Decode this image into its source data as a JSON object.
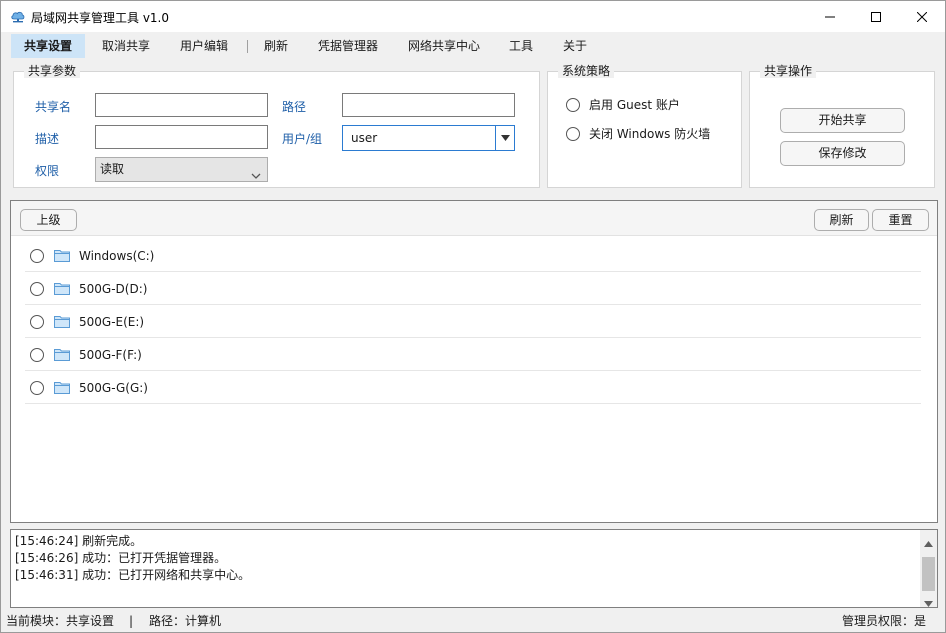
{
  "window": {
    "title": "局域网共享管理工具 v1.0",
    "icon": "cloud-network-icon"
  },
  "menu": {
    "items": [
      {
        "label": "共享设置",
        "active": true
      },
      {
        "label": "取消共享"
      },
      {
        "label": "用户编辑"
      },
      {
        "label": "刷新"
      },
      {
        "label": "凭据管理器"
      },
      {
        "label": "网络共享中心"
      },
      {
        "label": "工具"
      },
      {
        "label": "关于"
      }
    ]
  },
  "share_params": {
    "title": "共享参数",
    "share_name_label": "共享名",
    "share_name_value": "",
    "path_label": "路径",
    "path_value": "",
    "desc_label": "描述",
    "desc_value": "",
    "user_group_label": "用户/组",
    "user_group_value": "user",
    "permission_label": "权限",
    "permission_value": "读取"
  },
  "policy": {
    "title": "系统策略",
    "enable_guest": "启用 Guest 账户",
    "disable_firewall": "关闭 Windows 防火墙"
  },
  "share_ops": {
    "title": "共享操作",
    "start_share": "开始共享",
    "save_changes": "保存修改"
  },
  "browser": {
    "up_label": "上级",
    "refresh_label": "刷新",
    "reset_label": "重置",
    "drives": [
      {
        "name": "Windows(C:)"
      },
      {
        "name": "500G-D(D:)"
      },
      {
        "name": "500G-E(E:)"
      },
      {
        "name": "500G-F(F:)"
      },
      {
        "name": "500G-G(G:)"
      }
    ]
  },
  "log": {
    "lines": [
      "[15:46:24] 刷新完成。",
      "[15:46:26] 成功：已打开凭据管理器。",
      "[15:46:31] 成功：已打开网络和共享中心。"
    ]
  },
  "status": {
    "module": "当前模块：共享设置",
    "separator": "|",
    "path": "路径：计算机",
    "admin": "管理员权限：是"
  },
  "colors": {
    "accent": "#2b7bd1",
    "label_blue": "#1f5fa8",
    "menu_active": "#cde4f7",
    "folder": "#6fb0e6"
  }
}
